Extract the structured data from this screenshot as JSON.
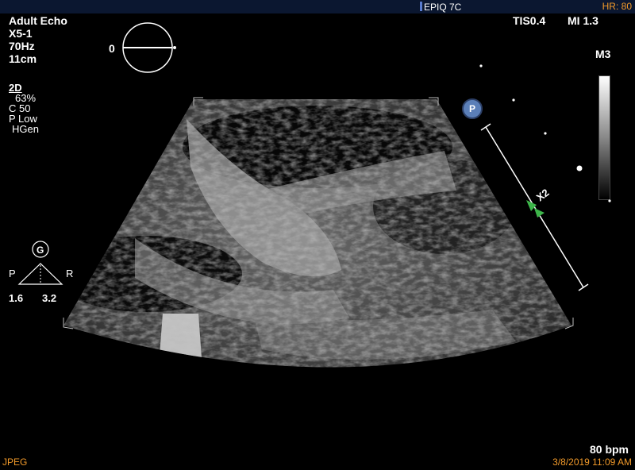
{
  "topbar": {
    "brand": "EPIQ 7C",
    "hr": "HR: 80"
  },
  "left_info": [
    "Adult Echo",
    "X5-1",
    "70Hz",
    "11cm"
  ],
  "probe_angle": "0",
  "mode": {
    "title": "2D",
    "lines": [
      "63%",
      "C 50",
      "P Low",
      "HGen"
    ]
  },
  "right_info": {
    "tis": "TIS0.4",
    "mi": "MI 1.3",
    "map": "M3"
  },
  "orientation": {
    "g": "G",
    "p": "P",
    "r": "R",
    "left_val": "1.6",
    "right_val": "3.2"
  },
  "markers": {
    "p_badge": "P",
    "x2": "X2"
  },
  "bottom": {
    "bpm": "80 bpm",
    "format": "JPEG",
    "timestamp": "3/8/2019 11:09 AM"
  },
  "colors": {
    "accent": "#f29a2a",
    "marker": "#3db54a",
    "badge": "#5b7fb8"
  }
}
